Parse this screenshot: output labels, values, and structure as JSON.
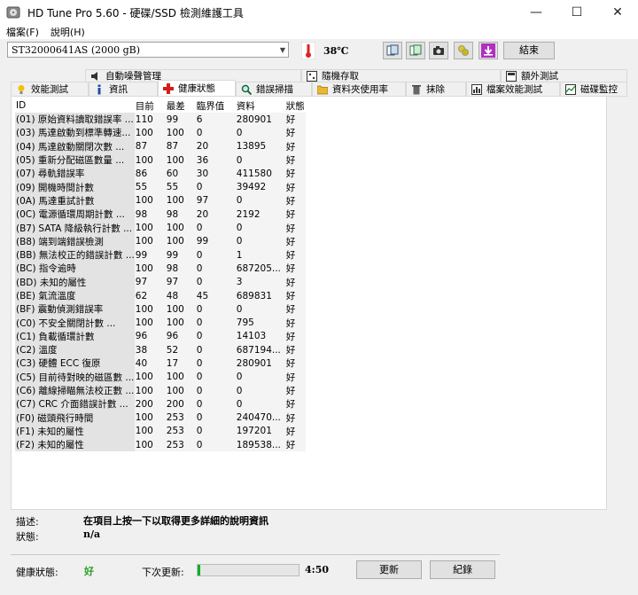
{
  "window": {
    "title": "HD Tune Pro 5.60 - 硬碟/SSD 檢測維護工具"
  },
  "menu": {
    "file": "檔案(F)",
    "help": "說明(H)"
  },
  "toolbar": {
    "drive": "ST32000641AS (2000 gB)",
    "temperature": "38℃",
    "exit_label": "結束"
  },
  "tabs_row1": [
    {
      "label": "自動噪聲管理"
    },
    {
      "label": "隨機存取"
    },
    {
      "label": "額外測試"
    }
  ],
  "tabs_row2": [
    {
      "label": "效能測試"
    },
    {
      "label": "資訊"
    },
    {
      "label": "健康狀態"
    },
    {
      "label": "錯誤掃描"
    },
    {
      "label": "資料夾使用率"
    },
    {
      "label": "抹除"
    },
    {
      "label": "檔案效能測試"
    },
    {
      "label": "磁碟監控"
    }
  ],
  "table": {
    "headers": {
      "id": "ID",
      "current": "目前",
      "worst": "最差",
      "threshold": "臨界值",
      "data": "資料",
      "status": "狀態"
    },
    "rows": [
      [
        "(01) 原始資料讀取錯誤率 ...",
        "110",
        "99",
        "6",
        "280901",
        "好"
      ],
      [
        "(03) 馬達啟動到標準轉速...",
        "100",
        "100",
        "0",
        "0",
        "好"
      ],
      [
        "(04) 馬達啟動關閉次數 ...",
        "87",
        "87",
        "20",
        "13895",
        "好"
      ],
      [
        "(05) 重新分配磁區數量 ...",
        "100",
        "100",
        "36",
        "0",
        "好"
      ],
      [
        "(07) 尋軌錯誤率",
        "86",
        "60",
        "30",
        "411580",
        "好"
      ],
      [
        "(09) 開機時間計數",
        "55",
        "55",
        "0",
        "39492",
        "好"
      ],
      [
        "(0A) 馬達重試計數",
        "100",
        "100",
        "97",
        "0",
        "好"
      ],
      [
        "(0C) 電源循環周期計數 ...",
        "98",
        "98",
        "20",
        "2192",
        "好"
      ],
      [
        "(B7) SATA 降級執行計數 ...",
        "100",
        "100",
        "0",
        "0",
        "好"
      ],
      [
        "(B8) 端到端錯誤檢測",
        "100",
        "100",
        "99",
        "0",
        "好"
      ],
      [
        "(BB) 無法校正的錯誤計數 ...",
        "99",
        "99",
        "0",
        "1",
        "好"
      ],
      [
        "(BC) 指令逾時",
        "100",
        "98",
        "0",
        "687205...",
        "好"
      ],
      [
        "(BD) 未知的屬性",
        "97",
        "97",
        "0",
        "3",
        "好"
      ],
      [
        "(BE) 氣流溫度",
        "62",
        "48",
        "45",
        "689831",
        "好"
      ],
      [
        "(BF) 震動偵測錯誤率",
        "100",
        "100",
        "0",
        "0",
        "好"
      ],
      [
        "(C0) 不安全關閉計數 ...",
        "100",
        "100",
        "0",
        "795",
        "好"
      ],
      [
        "(C1) 負載循環計數",
        "96",
        "96",
        "0",
        "14103",
        "好"
      ],
      [
        "(C2) 溫度",
        "38",
        "52",
        "0",
        "687194...",
        "好"
      ],
      [
        "(C3) 硬體 ECC 復原",
        "40",
        "17",
        "0",
        "280901",
        "好"
      ],
      [
        "(C5) 目前待對映的磁區數 ...",
        "100",
        "100",
        "0",
        "0",
        "好"
      ],
      [
        "(C6) 離線掃瞄無法校正數 ...",
        "100",
        "100",
        "0",
        "0",
        "好"
      ],
      [
        "(C7) CRC 介面錯誤計數 ...",
        "200",
        "200",
        "0",
        "0",
        "好"
      ],
      [
        "(F0) 磁頭飛行時間",
        "100",
        "253",
        "0",
        "240470...",
        "好"
      ],
      [
        "(F1) 未知的屬性",
        "100",
        "253",
        "0",
        "197201",
        "好"
      ],
      [
        "(F2) 未知的屬性",
        "100",
        "253",
        "0",
        "189538...",
        "好"
      ]
    ]
  },
  "details": {
    "desc_label": "描述:",
    "desc_value": "在項目上按一下以取得更多詳細的說明資訊",
    "status_label": "狀態:",
    "status_value": "n/a"
  },
  "footer": {
    "health_label": "健康狀態:",
    "health_value": "好",
    "next_update_label": "下次更新:",
    "progress_fraction": 0.03,
    "timer": "4:50",
    "refresh_label": "更新",
    "log_label": "紀錄"
  },
  "colors": {
    "progress": "#06b025",
    "health_ok": "#2aa02a"
  }
}
